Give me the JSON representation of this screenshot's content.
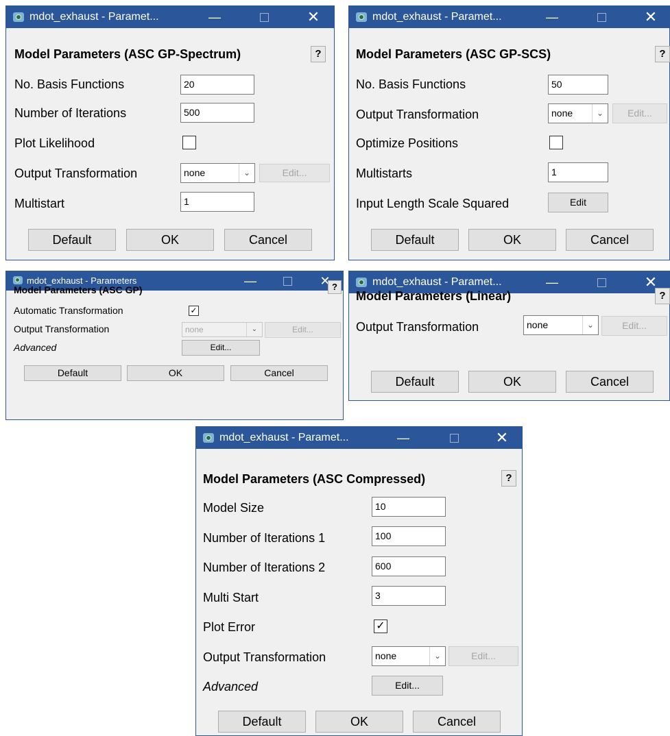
{
  "colors": {
    "titlebar": "#2b579a",
    "dialog_bg": "#f0f0f0",
    "button_bg": "#e1e1e1"
  },
  "icons": {
    "app": "app-icon",
    "minimize": "minimize-icon",
    "maximize": "maximize-icon",
    "close": "close-icon"
  },
  "window_controls": {
    "minimize": "—",
    "maximize": "",
    "close": "✕"
  },
  "dialogs": {
    "spectrum": {
      "title": "mdot_exhaust - Paramet...",
      "header": "Model Parameters (ASC GP-Spectrum)",
      "help": "?",
      "basis_label": "No. Basis Functions",
      "basis_value": "20",
      "iter_label": "Number of Iterations",
      "iter_value": "500",
      "plot_label": "Plot Likelihood",
      "plot_checked": "",
      "output_label": "Output Transformation",
      "output_value": "none",
      "edit_label": "Edit...",
      "multistart_label": "Multistart",
      "multistart_value": "1",
      "default_label": "Default",
      "ok_label": "OK",
      "cancel_label": "Cancel"
    },
    "scs": {
      "title": "mdot_exhaust - Paramet...",
      "header": "Model Parameters (ASC GP-SCS)",
      "help": "?",
      "basis_label": "No. Basis Functions",
      "basis_value": "50",
      "output_label": "Output Transformation",
      "output_value": "none",
      "edit_disabled_label": "Edit...",
      "optimize_label": "Optimize Positions",
      "optimize_checked": "",
      "multistarts_label": "Multistarts",
      "multistarts_value": "1",
      "length_label": "Input Length Scale Squared",
      "length_edit_label": "Edit",
      "default_label": "Default",
      "ok_label": "OK",
      "cancel_label": "Cancel"
    },
    "gp": {
      "title": "mdot_exhaust - Parameters",
      "header": "Model Parameters (ASC GP)",
      "help": "?",
      "auto_label": "Automatic Transformation",
      "auto_checked": "✓",
      "output_label": "Output Transformation",
      "output_value": "none",
      "edit_disabled_label": "Edit...",
      "advanced_label": "Advanced",
      "advanced_edit_label": "Edit...",
      "default_label": "Default",
      "ok_label": "OK",
      "cancel_label": "Cancel"
    },
    "linear": {
      "title": "mdot_exhaust - Paramet...",
      "header": "Model Parameters (Linear)",
      "help": "?",
      "output_label": "Output Transformation",
      "output_value": "none",
      "edit_disabled_label": "Edit...",
      "default_label": "Default",
      "ok_label": "OK",
      "cancel_label": "Cancel"
    },
    "compressed": {
      "title": "mdot_exhaust - Paramet...",
      "header": "Model Parameters (ASC Compressed)",
      "help": "?",
      "size_label": "Model Size",
      "size_value": "10",
      "iter1_label": "Number of Iterations 1",
      "iter1_value": "100",
      "iter2_label": "Number of Iterations 2",
      "iter2_value": "600",
      "multi_label": "Multi Start",
      "multi_value": "3",
      "plot_label": "Plot Error",
      "plot_checked": "✓",
      "output_label": "Output Transformation",
      "output_value": "none",
      "edit_disabled_label": "Edit...",
      "advanced_label": "Advanced",
      "advanced_edit_label": "Edit...",
      "default_label": "Default",
      "ok_label": "OK",
      "cancel_label": "Cancel"
    }
  }
}
